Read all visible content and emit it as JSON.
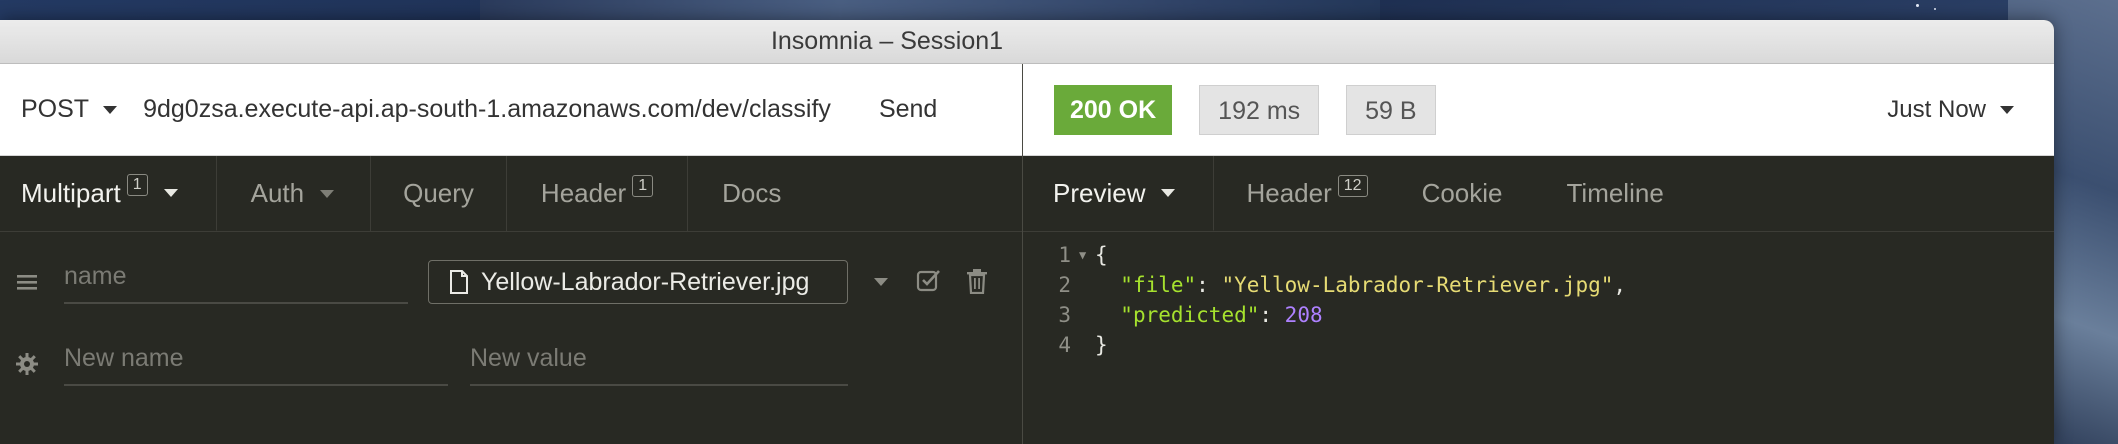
{
  "window": {
    "title": "Insomnia – Session1"
  },
  "request": {
    "method": "POST",
    "url": "9dg0zsa.execute-api.ap-south-1.amazonaws.com/dev/classify",
    "send_label": "Send",
    "tabs": [
      {
        "label": "Multipart",
        "count": "1",
        "active": true
      },
      {
        "label": "Auth"
      },
      {
        "label": "Query"
      },
      {
        "label": "Header",
        "count": "1"
      },
      {
        "label": "Docs"
      }
    ],
    "form": {
      "row1": {
        "name_placeholder": "name",
        "file_label": "Yellow-Labrador-Retriever.jpg"
      },
      "row2": {
        "name_placeholder": "New name",
        "value_placeholder": "New value"
      }
    }
  },
  "response": {
    "status": "200 OK",
    "time": "192 ms",
    "size": "59 B",
    "history": "Just Now",
    "tabs": [
      {
        "label": "Preview",
        "active": true
      },
      {
        "label": "Header",
        "count": "12"
      },
      {
        "label": "Cookie"
      },
      {
        "label": "Timeline"
      }
    ],
    "body": {
      "line_numbers": [
        "1",
        "2",
        "3",
        "4"
      ],
      "open_brace": "{",
      "file_key": "\"file\"",
      "file_value": "\"Yellow-Labrador-Retriever.jpg\"",
      "predicted_key": "\"predicted\"",
      "predicted_value": "208",
      "close_brace": "}"
    }
  },
  "colors": {
    "status_ok": "#6aaa3a",
    "editor_bg": "#282923",
    "json_key": "#a6e22e",
    "json_string": "#e6db74",
    "json_number": "#ae81ff"
  }
}
